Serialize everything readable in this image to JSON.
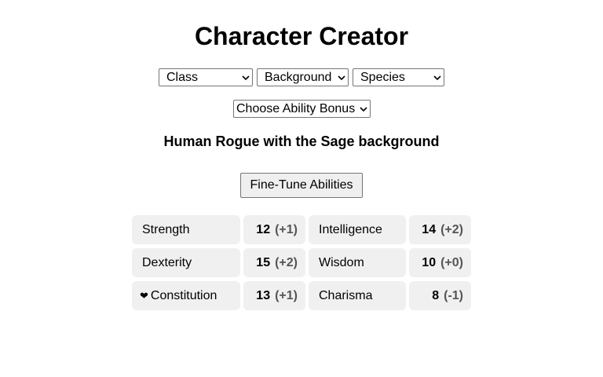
{
  "title": "Character Creator",
  "selects": {
    "class": {
      "icon": "",
      "label": "Class",
      "icon_name": "class-icon"
    },
    "background": {
      "icon": "",
      "label": "Background",
      "icon_name": "background-icon"
    },
    "species": {
      "icon": "",
      "label": "Species",
      "icon_name": "species-icon"
    },
    "ability_bonus": {
      "label": "Choose Ability Bonus"
    }
  },
  "summary": "Human Rogue with the Sage background",
  "fine_tune_label": "Fine-Tune Abilities",
  "abilities": [
    {
      "icon": "",
      "name": "Strength",
      "score": "12",
      "modifier": "(+1)"
    },
    {
      "icon": "",
      "name": "Dexterity",
      "score": "15",
      "modifier": "(+2)"
    },
    {
      "icon": "❤",
      "name": "Constitution",
      "score": "13",
      "modifier": "(+1)"
    },
    {
      "icon": "",
      "name": "Intelligence",
      "score": "14",
      "modifier": "(+2)"
    },
    {
      "icon": "",
      "name": "Wisdom",
      "score": "10",
      "modifier": "(+0)"
    },
    {
      "icon": "",
      "name": "Charisma",
      "score": "8",
      "modifier": "(-1)"
    }
  ]
}
